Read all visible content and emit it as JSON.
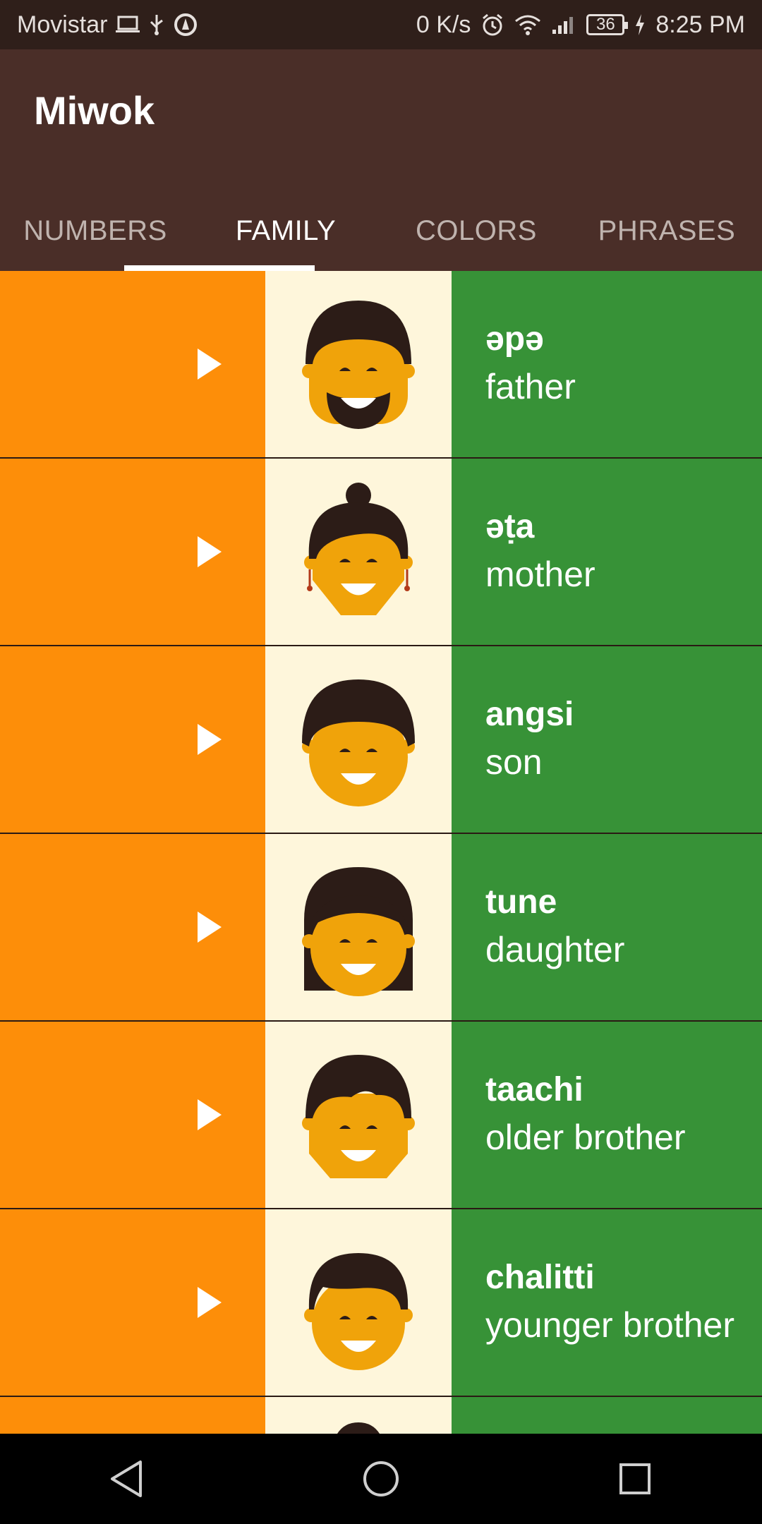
{
  "status_bar": {
    "carrier": "Movistar",
    "icons_left": [
      "laptop-icon",
      "usb-icon",
      "app-icon"
    ],
    "speed": "0 K/s",
    "icons_right": [
      "alarm-icon",
      "wifi-icon",
      "signal-icon"
    ],
    "battery": "36",
    "time": "8:25 PM"
  },
  "app_bar": {
    "title": "Miwok",
    "background": "#4A2E28"
  },
  "tabs": [
    {
      "label": "NUMBERS",
      "active": false
    },
    {
      "label": "FAMILY",
      "active": true
    },
    {
      "label": "COLORS",
      "active": false
    },
    {
      "label": "PHRASES",
      "active": false
    }
  ],
  "list": {
    "play_color": "#FD8E09",
    "image_bg": "#FEF6DB",
    "text_bg": "#379237",
    "items": [
      {
        "miwok": "әpә",
        "english": "father",
        "icon": "father-icon"
      },
      {
        "miwok": "әṭa",
        "english": "mother",
        "icon": "mother-icon"
      },
      {
        "miwok": "angsi",
        "english": "son",
        "icon": "son-icon"
      },
      {
        "miwok": "tune",
        "english": "daughter",
        "icon": "daughter-icon"
      },
      {
        "miwok": "taachi",
        "english": "older brother",
        "icon": "older-brother-icon"
      },
      {
        "miwok": "chalitti",
        "english": "younger brother",
        "icon": "younger-brother-icon"
      }
    ]
  },
  "nav_bar": {
    "buttons": [
      "back-icon",
      "home-icon",
      "recents-icon"
    ]
  }
}
